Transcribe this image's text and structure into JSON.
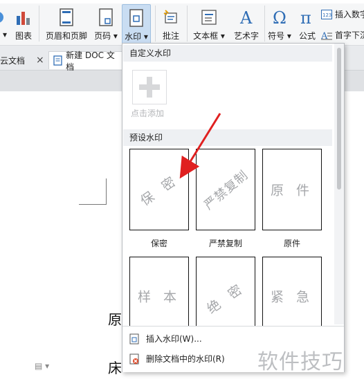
{
  "ribbon": {
    "chart_label": "图表",
    "header_footer_label": "页眉和页脚",
    "page_number_label": "页码",
    "watermark_label": "水印",
    "comment_label": "批注",
    "textbox_label": "文本框",
    "wordart_label": "艺术字",
    "symbol_label": "符号",
    "formula_label": "公式",
    "insert_number_label": "插入数字",
    "drop_cap_label": "首字下沉"
  },
  "tabs": {
    "left_tab_label": "云文档",
    "new_doc_tab_label": "新建 DOC 文档"
  },
  "dropdown": {
    "custom_section_title": "自定义水印",
    "add_label": "点击添加",
    "preset_section_title": "预设水印",
    "presets": [
      {
        "text": "保 密",
        "caption": "保密"
      },
      {
        "text": "严禁复制",
        "caption": "严禁复制"
      },
      {
        "text": "原 件",
        "caption": "原件"
      },
      {
        "text": "样 本",
        "caption": ""
      },
      {
        "text": "绝 密",
        "caption": ""
      },
      {
        "text": "紧 急",
        "caption": ""
      }
    ],
    "insert_watermark_label": "插入水印(W)...",
    "delete_watermark_label": "删除文档中的水印(R)"
  },
  "document": {
    "line1": "原",
    "line2": "床"
  },
  "brand": {
    "text": "软件技巧"
  },
  "colors": {
    "accent_blue": "#2f6db5",
    "arrow_red": "#e02020",
    "watermark_gray": "#a5a7aa"
  }
}
